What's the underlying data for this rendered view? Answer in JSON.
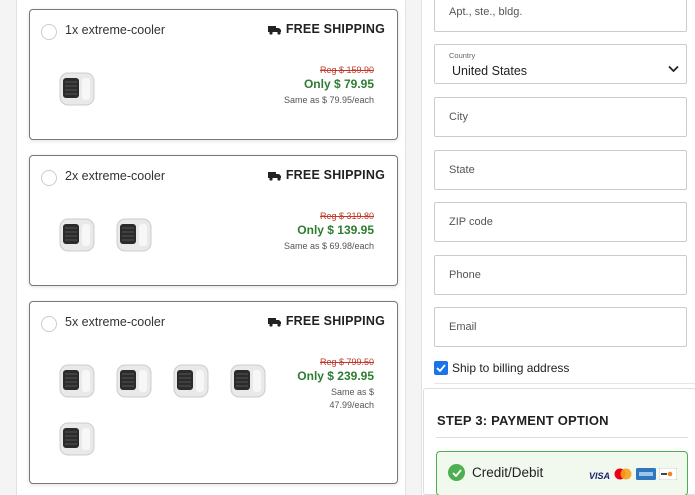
{
  "packages": [
    {
      "title": "1x extreme-cooler",
      "shipping": "FREE SHIPPING",
      "reg_price": "Reg $ 159.90",
      "only_price": "Only $ 79.95",
      "each_line1": "Same as $ 79.95/each",
      "each_line2": "",
      "thumb_count": 1
    },
    {
      "title": "2x extreme-cooler",
      "shipping": "FREE SHIPPING",
      "reg_price": "Reg $ 319.80",
      "only_price": "Only $ 139.95",
      "each_line1": "Same as $ 69.98/each",
      "each_line2": "",
      "thumb_count": 2
    },
    {
      "title": "5x extreme-cooler",
      "shipping": "FREE SHIPPING",
      "reg_price": "Reg $ 799.50",
      "only_price": "Only $ 239.95",
      "each_line1": "Same as $",
      "each_line2": "47.99/each",
      "thumb_count": 5
    }
  ],
  "form": {
    "apt_placeholder": "Apt., ste., bldg.",
    "country_label": "Country",
    "country_value": "United States",
    "city_placeholder": "City",
    "state_placeholder": "State",
    "zip_placeholder": "ZIP code",
    "phone_placeholder": "Phone",
    "email_placeholder": "Email",
    "ship_to_billing": "Ship to billing address",
    "ship_to_billing_checked": true
  },
  "payment": {
    "step_title": "STEP 3: PAYMENT OPTION",
    "option_label": "Credit/Debit",
    "card_icons": [
      "visa-icon",
      "mastercard-icon",
      "amex-icon",
      "discover-icon"
    ],
    "visa_text": "VISA"
  },
  "colors": {
    "reg_price": "#c0392b",
    "only_price": "#2e7d32",
    "selected_border": "#4caf50",
    "checkbox": "#1a73e8"
  }
}
